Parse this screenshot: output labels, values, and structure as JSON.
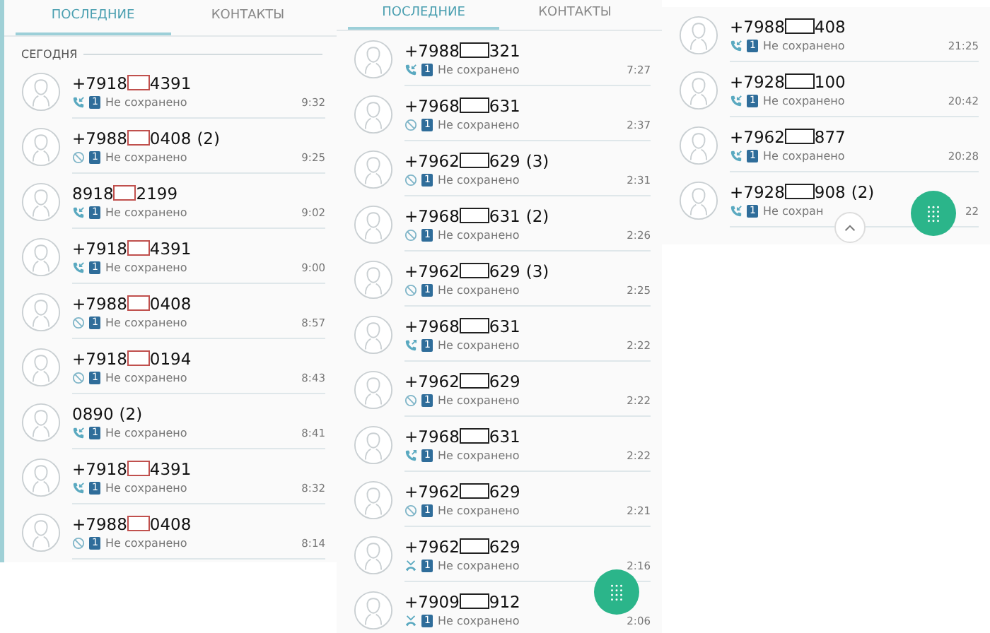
{
  "panels": [
    {
      "tabs": [
        {
          "label": "ПОСЛЕДНИЕ",
          "selected": true
        },
        {
          "label": "КОНТАКТЫ",
          "selected": false
        }
      ],
      "section": "СЕГОДНЯ",
      "color": "#c0504d",
      "rows": [
        {
          "prefix": "+7918",
          "suffix": "4391",
          "kind": "incoming",
          "sim": "1",
          "status": "Не сохранено",
          "time": "9:32"
        },
        {
          "prefix": "+7988",
          "suffix": "0408",
          "count": "(2)",
          "kind": "blocked",
          "sim": "1",
          "status": "Не сохранено",
          "time": "9:25"
        },
        {
          "prefix": "8918",
          "suffix": "2199",
          "kind": "incoming",
          "sim": "1",
          "status": "Не сохранено",
          "time": "9:02"
        },
        {
          "prefix": "+7918",
          "suffix": "4391",
          "kind": "incoming",
          "sim": "1",
          "status": "Не сохранено",
          "time": "9:00"
        },
        {
          "prefix": "+7988",
          "suffix": "0408",
          "kind": "blocked",
          "sim": "1",
          "status": "Не сохранено",
          "time": "8:57"
        },
        {
          "prefix": "+7918",
          "suffix": "0194",
          "kind": "blocked",
          "sim": "1",
          "status": "Не сохранено",
          "time": "8:43"
        },
        {
          "prefix": "0890",
          "count": "(2)",
          "kind": "incoming",
          "sim": "1",
          "status": "Не сохранено",
          "time": "8:41"
        },
        {
          "prefix": "+7918",
          "suffix": "4391",
          "kind": "incoming",
          "sim": "1",
          "status": "Не сохранено",
          "time": "8:32"
        },
        {
          "prefix": "+7988",
          "suffix": "0408",
          "kind": "blocked",
          "sim": "1",
          "status": "Не сохранено",
          "time": "8:14"
        }
      ]
    },
    {
      "tabs": [
        {
          "label": "ПОСЛЕДНИЕ",
          "selected": true
        },
        {
          "label": "КОНТАКТЫ",
          "selected": false
        }
      ],
      "color": "#222222",
      "fab": true,
      "rows": [
        {
          "prefix": "+7988",
          "suffix": "321",
          "kind": "incoming",
          "sim": "1",
          "status": "Не сохранено",
          "time": "7:27"
        },
        {
          "prefix": "+7968",
          "suffix": "631",
          "kind": "blocked",
          "sim": "1",
          "status": "Не сохранено",
          "time": "2:37"
        },
        {
          "prefix": "+7962",
          "suffix": "629",
          "count": "(3)",
          "kind": "blocked",
          "sim": "1",
          "status": "Не сохранено",
          "time": "2:31"
        },
        {
          "prefix": "+7968",
          "suffix": "631",
          "count": "(2)",
          "kind": "blocked",
          "sim": "1",
          "status": "Не сохранено",
          "time": "2:26"
        },
        {
          "prefix": "+7962",
          "suffix": "629",
          "count": "(3)",
          "kind": "blocked",
          "sim": "1",
          "status": "Не сохранено",
          "time": "2:25"
        },
        {
          "prefix": "+7968",
          "suffix": "631",
          "kind": "outgoing",
          "sim": "1",
          "status": "Не сохранено",
          "time": "2:22"
        },
        {
          "prefix": "+7962",
          "suffix": "629",
          "kind": "blocked",
          "sim": "1",
          "status": "Не сохранено",
          "time": "2:22"
        },
        {
          "prefix": "+7968",
          "suffix": "631",
          "kind": "outgoing",
          "sim": "1",
          "status": "Не сохранено",
          "time": "2:22"
        },
        {
          "prefix": "+7962",
          "suffix": "629",
          "kind": "blocked",
          "sim": "1",
          "status": "Не сохранено",
          "time": "2:21"
        },
        {
          "prefix": "+7962",
          "suffix": "629",
          "kind": "rejected",
          "sim": "1",
          "status": "Не сохранено",
          "time": "2:16"
        },
        {
          "prefix": "+7909",
          "suffix": "912",
          "kind": "rejected",
          "sim": "1",
          "status": "Не сохранено",
          "time": "2:06"
        }
      ]
    },
    {
      "color": "#222222",
      "fab": true,
      "scroll_up": true,
      "rows": [
        {
          "prefix": "+7988",
          "suffix": "408",
          "kind": "incoming",
          "sim": "1",
          "status": "Не сохранено",
          "time": "21:25"
        },
        {
          "prefix": "+7928",
          "suffix": "100",
          "kind": "incoming",
          "sim": "1",
          "status": "Не сохранено",
          "time": "20:42"
        },
        {
          "prefix": "+7962",
          "suffix": "877",
          "kind": "incoming",
          "sim": "1",
          "status": "Не сохранено",
          "time": "20:28"
        },
        {
          "prefix": "+7928",
          "suffix": "908",
          "count": "(2)",
          "kind": "incoming",
          "sim": "1",
          "status": "Не сохран",
          "time": "22"
        }
      ]
    }
  ]
}
